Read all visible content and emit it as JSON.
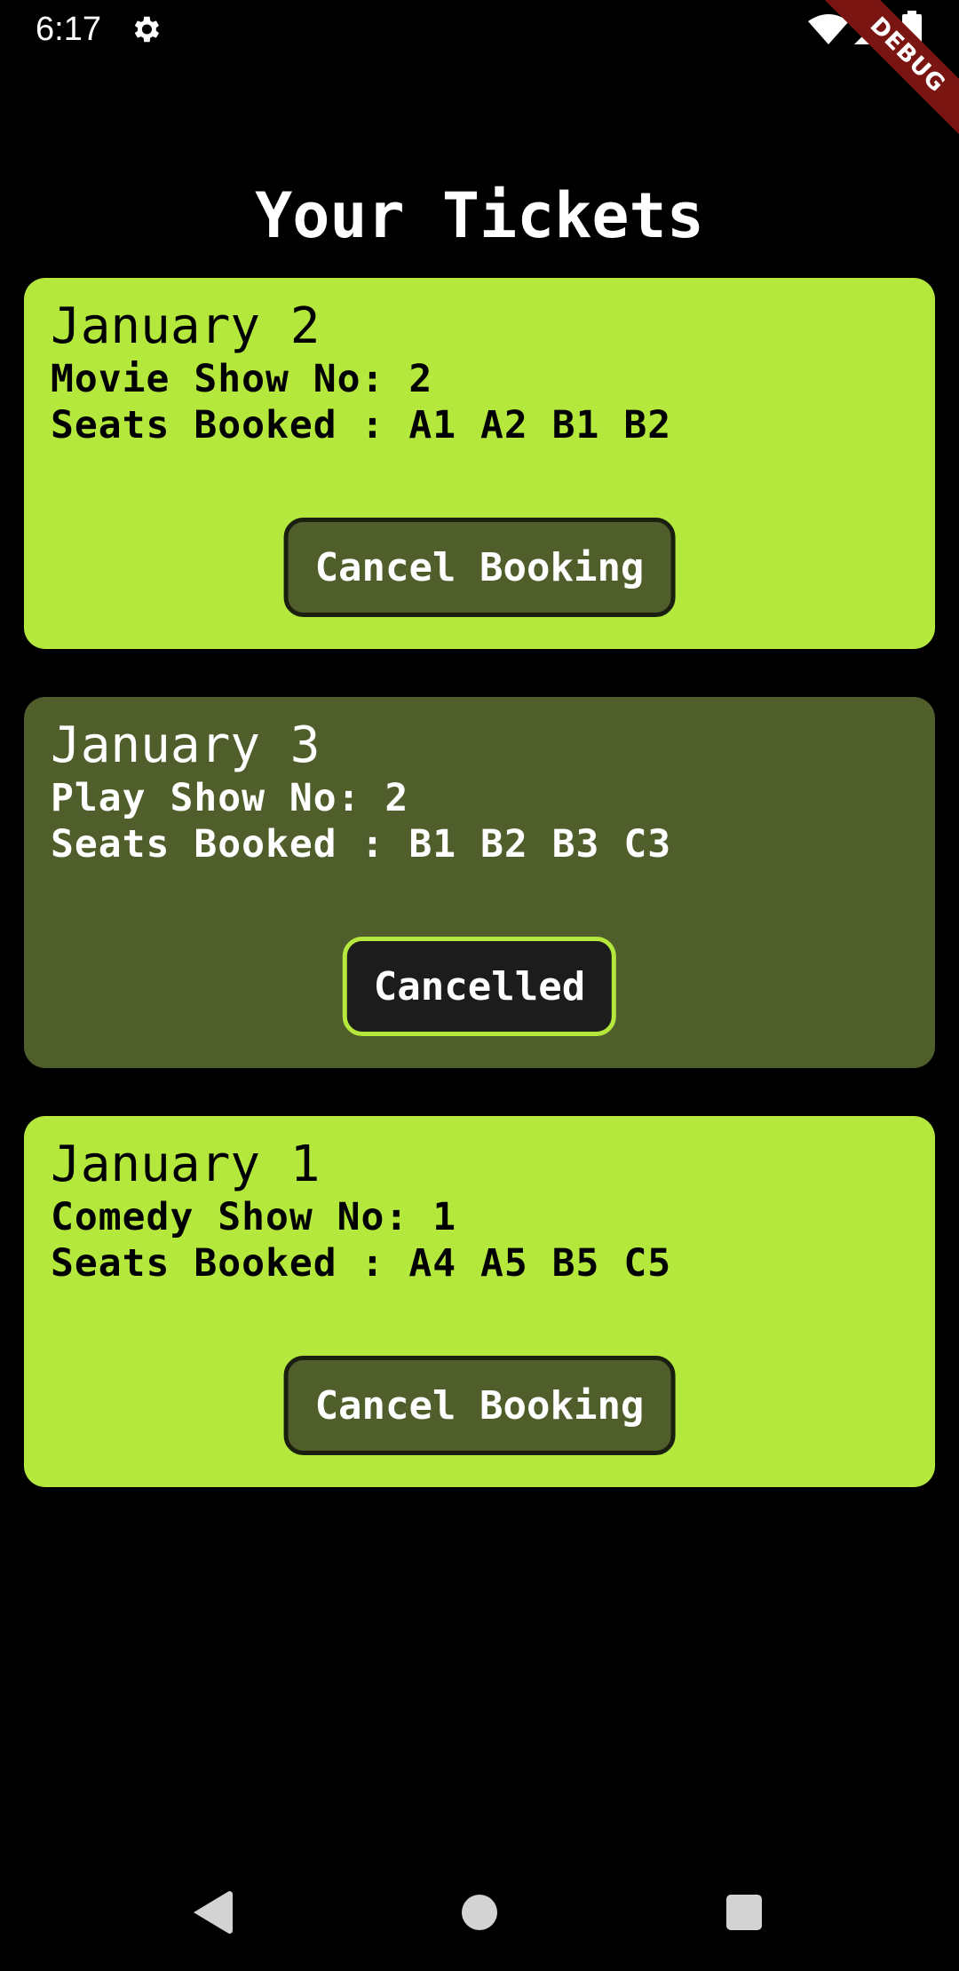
{
  "status_bar": {
    "time": "6:17",
    "icons": [
      "gear-icon",
      "wifi-icon",
      "signal-icon",
      "battery-icon"
    ],
    "debug_label": "DEBUG"
  },
  "header": {
    "title": "Your Tickets"
  },
  "tickets": [
    {
      "date": "January 2",
      "show": "Movie Show No: 2",
      "seats": "Seats Booked : A1 A2 B1 B2",
      "button_label": "Cancel Booking",
      "status": "active"
    },
    {
      "date": "January 3",
      "show": "Play Show No: 2",
      "seats": "Seats Booked : B1 B2 B3 C3",
      "button_label": "Cancelled",
      "status": "cancelled"
    },
    {
      "date": "January 1",
      "show": "Comedy Show No: 1",
      "seats": "Seats Booked : A4 A5 B5 C5",
      "button_label": "Cancel Booking",
      "status": "active"
    }
  ],
  "nav_bar": {
    "icons": [
      "back-icon",
      "home-icon",
      "recents-icon"
    ]
  },
  "colors": {
    "background": "#000000",
    "card_active": "#b5e83d",
    "card_cancelled": "#4f5e2a",
    "button_dark": "#4f5e2a",
    "button_cancelled_bg": "#1c1c1c",
    "debug_ribbon": "#7a1512"
  }
}
